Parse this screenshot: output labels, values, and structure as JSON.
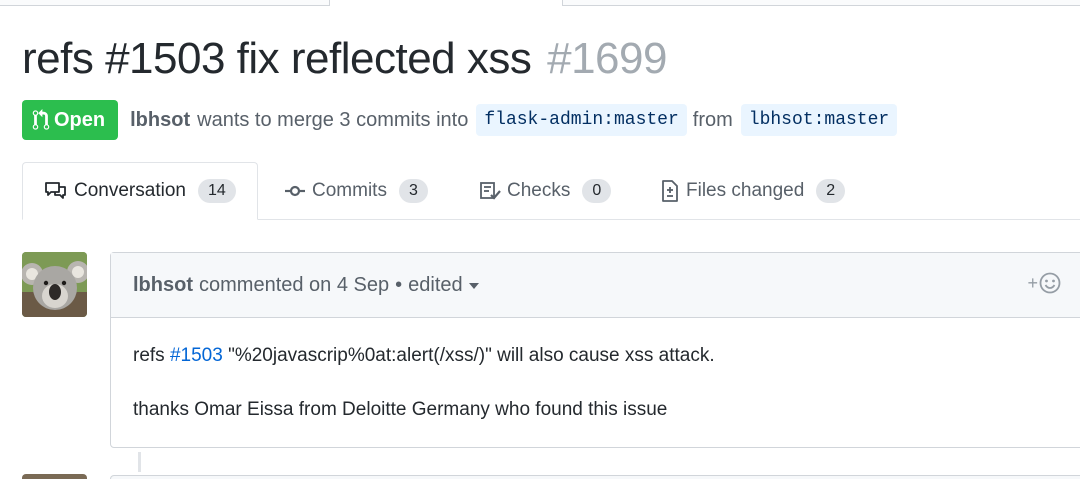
{
  "pr": {
    "title": "refs #1503 fix reflected xss",
    "number": "#1699",
    "state": "Open",
    "author": "lbhsot",
    "merge_text": "wants to merge 3 commits into",
    "base_branch": "flask-admin:master",
    "from_text": "from",
    "head_branch": "lbhsot:master"
  },
  "tabs": [
    {
      "label": "Conversation",
      "count": "14",
      "icon": "comment-discussion-icon"
    },
    {
      "label": "Commits",
      "count": "3",
      "icon": "git-commit-icon"
    },
    {
      "label": "Checks",
      "count": "0",
      "icon": "checklist-icon"
    },
    {
      "label": "Files changed",
      "count": "2",
      "icon": "diff-icon"
    }
  ],
  "comment": {
    "author": "lbhsot",
    "action": "commented on 4 Sep",
    "separator": "•",
    "edited": "edited",
    "reaction_plus": "+",
    "body_prefix": "refs",
    "issue_link": "#1503",
    "body_rest": "\"%20javascrip%0at:alert(/xss/)\" will also cause xss attack.",
    "body_line2": "thanks Omar Eissa from Deloitte Germany who found this issue"
  },
  "colors": {
    "open_green": "#2cbe4e",
    "link_blue": "#0366d6",
    "branch_bg": "#eaf5ff"
  }
}
